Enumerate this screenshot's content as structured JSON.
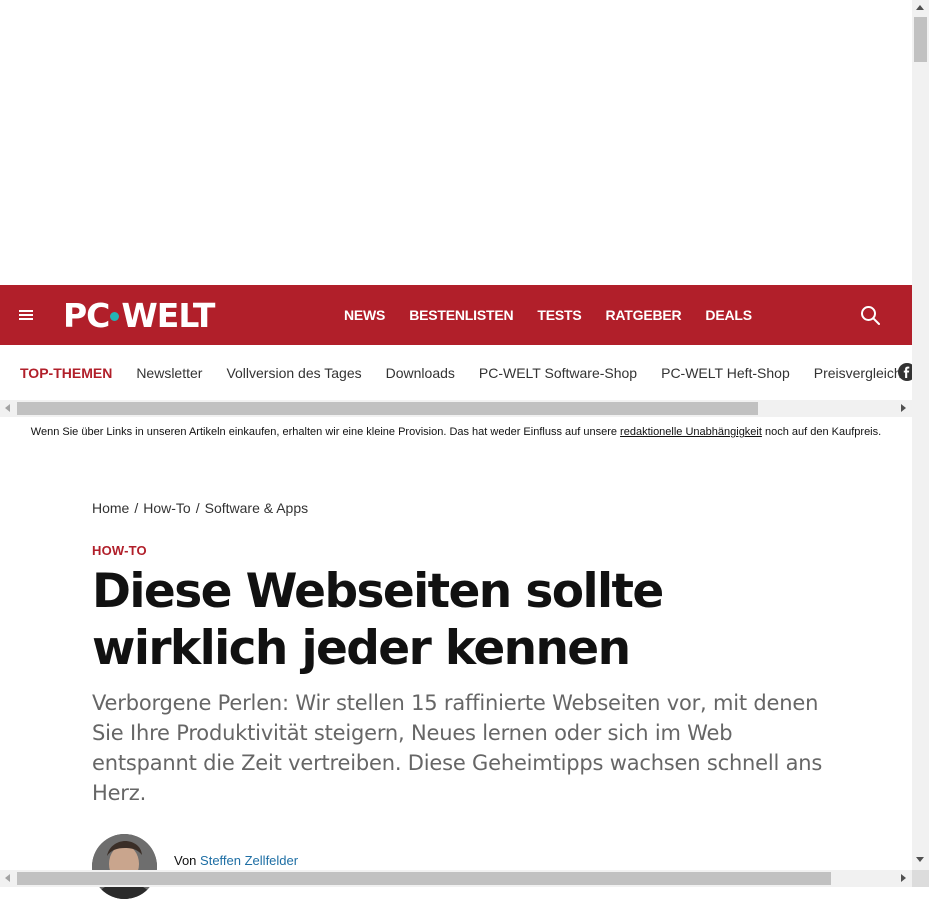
{
  "header": {
    "logo_left": "PC",
    "logo_right": "WELT",
    "nav": [
      "NEWS",
      "BESTENLISTEN",
      "TESTS",
      "RATGEBER",
      "DEALS"
    ],
    "colors": {
      "brand_red": "#b11f2a",
      "logo_dot": "#23b5b5"
    },
    "icons": {
      "menu": "hamburger-menu-icon",
      "search": "search-icon"
    }
  },
  "subnav": {
    "items": [
      "TOP-THEMEN",
      "Newsletter",
      "Vollversion des Tages",
      "Downloads",
      "PC-WELT Software-Shop",
      "PC-WELT Heft-Shop",
      "Preisvergleich"
    ],
    "social_icon": "facebook-icon"
  },
  "disclaimer": {
    "before": "Wenn Sie über Links in unseren Artikeln einkaufen, erhalten wir eine kleine Provision. Das hat weder Einfluss auf unsere ",
    "link": "redaktionelle Unabhängigkeit",
    "after": " noch auf den Kaufpreis."
  },
  "breadcrumb": [
    "Home",
    "How-To",
    "Software & Apps"
  ],
  "breadcrumb_separator": "/",
  "article": {
    "kicker": "HOW-TO",
    "title": "Diese Webseiten sollte wirklich jeder kennen",
    "subtitle": "Verborgene Perlen: Wir stellen 15 raffinierte Webseiten vor, mit denen Sie Ihre Produktivität steigern, Neues lernen oder sich im Web entspannt die Zeit vertreiben. Diese Geheimtipps wachsen schnell ans Herz.",
    "author_prefix": "Von",
    "author_name": "Steffen Zellfelder"
  }
}
